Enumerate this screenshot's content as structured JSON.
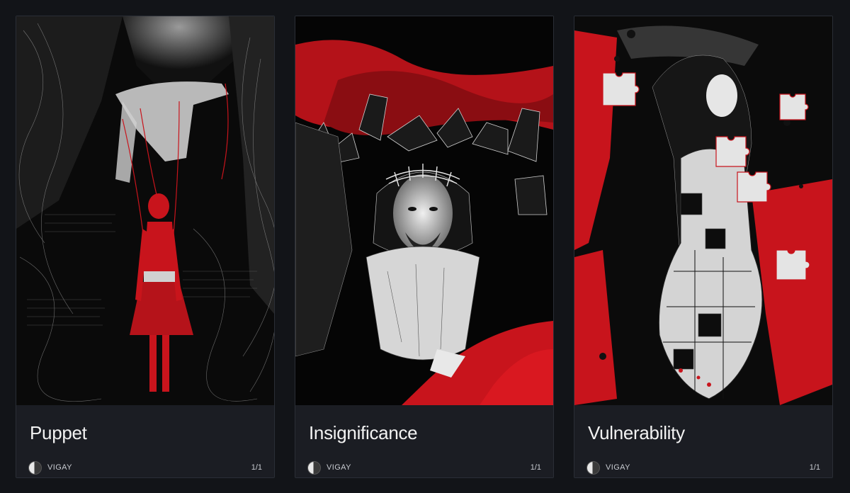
{
  "cards": [
    {
      "title": "Puppet",
      "artist": "VIGAY",
      "edition": "1/1",
      "artwork_icon": "marionette-illustration"
    },
    {
      "title": "Insignificance",
      "artist": "VIGAY",
      "edition": "1/1",
      "artwork_icon": "crowned-figure-illustration"
    },
    {
      "title": "Vulnerability",
      "artist": "VIGAY",
      "edition": "1/1",
      "artwork_icon": "puzzle-figure-illustration"
    }
  ],
  "colors": {
    "background": "#121418",
    "card": "#1b1d23",
    "accent_red": "#c8141c",
    "text": "#f2f2f2"
  }
}
